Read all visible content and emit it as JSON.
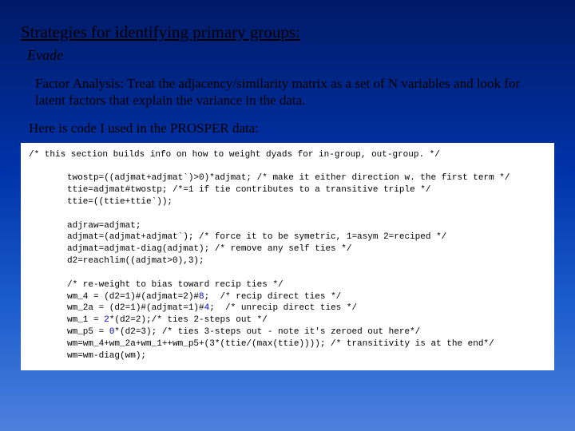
{
  "title": "Strategies for identifying primary groups:",
  "subtitle": "Evade",
  "body": "Factor Analysis:  Treat the adjacency/similarity matrix as a set of N variables and look for latent factors that explain the variance in the data.",
  "body2": "Here is code I used in the PROSPER data:",
  "code": {
    "c0": "/* this section builds info on how to weight dyads for in-group, out-group. */",
    "c1": "twostp=((adjmat+adjmat`)>0)*adjmat; /* make it either direction w. the first term */",
    "c2": "ttie=adjmat#twostp; /*=1 if tie contributes to a transitive triple */",
    "c3": "ttie=((ttie+ttie`));",
    "c4": "adjraw=adjmat;",
    "c5": "adjmat=(adjmat+adjmat`); /* force it to be symetric, 1=asym 2=reciped */",
    "c6": "adjmat=adjmat-diag(adjmat); /* remove any self ties */",
    "c7": "d2=reachlim((adjmat>0),3);",
    "c8": "/* re-weight to bias toward recip ties */",
    "c9a": "wm_4 = (d2=1)#(adjmat=2)#",
    "c9b": "8",
    "c9c": ";  /* recip direct ties */",
    "c10a": "wm_2a = (d2=1)#(adjmat=1)#",
    "c10b": "4",
    "c10c": ";  /* unrecip direct ties */",
    "c11a": "wm_1 = ",
    "c11b": "2",
    "c11c": "*(d2=2);/* ties 2-steps out */",
    "c12a": "wm_p5 = ",
    "c12b": "0",
    "c12c": "*(d2=3); /* ties 3-steps out - note it's zeroed out here*/",
    "c13": "wm=wm_4+wm_2a+wm_1++wm_p5+(3*(ttie/(max(ttie)))); /* transitivity is at the end*/",
    "c14": "wm=wm-diag(wm);"
  }
}
